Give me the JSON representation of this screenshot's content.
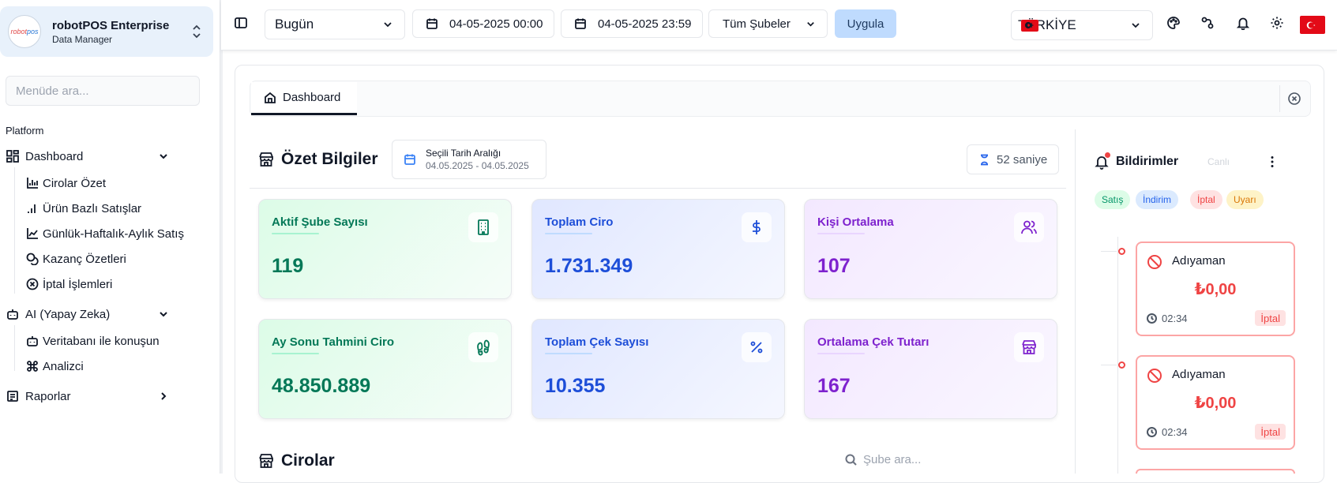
{
  "sidebar": {
    "brand_title": "robotPOS Enterprise",
    "brand_subtitle": "Data Manager",
    "logo_text_a": "robot",
    "logo_text_b": "pos",
    "search_placeholder": "Menüde ara...",
    "section": "Platform",
    "items": [
      {
        "label": "Dashboard",
        "icon": "dashboard-icon",
        "expanded": true
      },
      {
        "label": "Cirolar Özet",
        "icon": "bar-chart-icon"
      },
      {
        "label": "Ürün Bazlı Satışlar",
        "icon": "signal-bars-icon"
      },
      {
        "label": "Günlük-Haftalık-Aylık Satış",
        "icon": "line-chart-icon"
      },
      {
        "label": "Kazanç Özetleri",
        "icon": "coins-icon"
      },
      {
        "label": "İptal İşlemleri",
        "icon": "circle-x-icon"
      },
      {
        "label": "AI (Yapay Zeka)",
        "icon": "bot-icon",
        "expanded": true
      },
      {
        "label": "Veritabanı ile konuşun",
        "icon": "bot-icon"
      },
      {
        "label": "Analizci",
        "icon": "command-icon"
      },
      {
        "label": "Raporlar",
        "icon": "report-icon",
        "expanded": false
      }
    ]
  },
  "topbar": {
    "period": "Bugün",
    "start_date": "04-05-2025 00:00",
    "end_date": "04-05-2025 23:59",
    "branches": "Tüm Şubeler",
    "apply_label": "Uygula",
    "country": "TÜRKİYE"
  },
  "tabs": [
    {
      "label": "Dashboard"
    }
  ],
  "summary": {
    "title": "Özet Bilgiler",
    "range_title": "Seçili Tarih Aralığı",
    "range_value": "04.05.2025 - 04.05.2025",
    "timer_value": "52",
    "timer_unit": "saniye",
    "cards": [
      {
        "label": "Aktif Şube Sayısı",
        "value": "119",
        "icon": "building-icon"
      },
      {
        "label": "Toplam Ciro",
        "value": "1.731.349",
        "icon": "dollar-icon"
      },
      {
        "label": "Kişi Ortalama",
        "value": "107",
        "icon": "users-icon"
      },
      {
        "label": "Ay Sonu Tahmini Ciro",
        "value": "48.850.889",
        "icon": "footprints-icon"
      },
      {
        "label": "Toplam Çek Sayısı",
        "value": "10.355",
        "icon": "percent-icon"
      },
      {
        "label": "Ortalama Çek Tutarı",
        "value": "167",
        "icon": "store-icon"
      }
    ]
  },
  "cirolar": {
    "title": "Cirolar",
    "search_placeholder": "Şube ara..."
  },
  "notifications": {
    "title": "Bildirimler",
    "live_label": "Canlı",
    "filters": [
      "Satış",
      "İndirim",
      "İptal",
      "Uyarı"
    ],
    "items": [
      {
        "city": "Adıyaman",
        "amount": "₺0,00",
        "time": "02:34",
        "tag": "İptal"
      },
      {
        "city": "Adıyaman",
        "amount": "₺0,00",
        "time": "02:34",
        "tag": "İptal"
      }
    ]
  },
  "colors": {
    "accent": "#bfdbfe",
    "danger": "#ef4444",
    "green": "#047857",
    "blue": "#1d4ed8",
    "purple": "#7e22ce"
  }
}
